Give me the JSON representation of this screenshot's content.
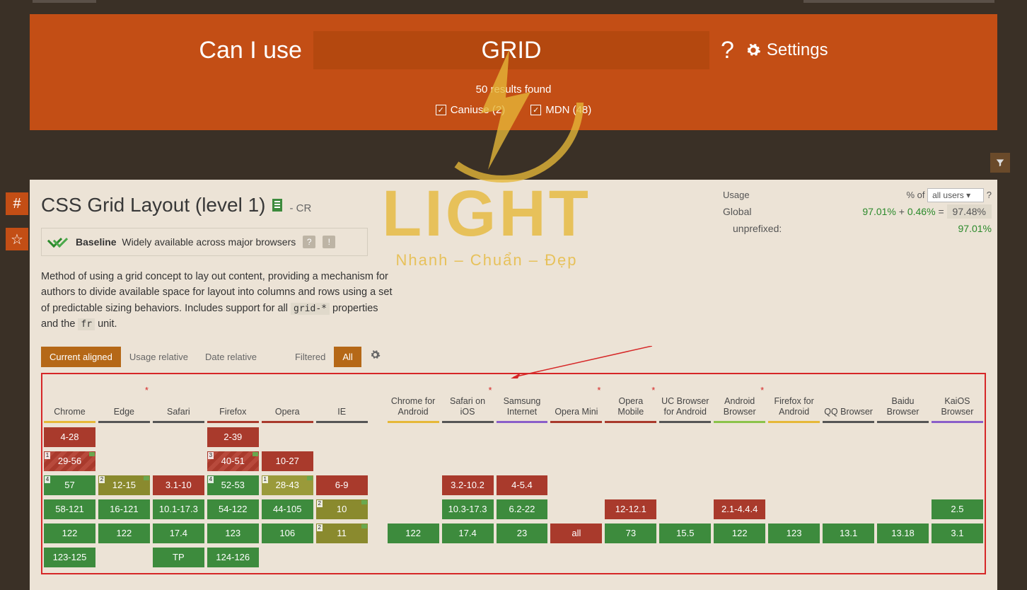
{
  "hero": {
    "label": "Can I use",
    "search_value": "GRID",
    "question": "?",
    "settings": "Settings",
    "results": "50 results found",
    "filter_caniuse": "Caniuse (2)",
    "filter_mdn": "MDN (48)"
  },
  "feature": {
    "title": "CSS Grid Layout (level 1)",
    "status": "- CR",
    "baseline_bold": "Baseline",
    "baseline_text": "Widely available across major browsers",
    "description": "Method of using a grid concept to lay out content, providing a mechanism for authors to divide available space for layout into columns and rows using a set of predictable sizing behaviors. Includes support for all ",
    "code1": "grid-*",
    "desc_mid": " properties and the ",
    "code2": "fr",
    "desc_end": " unit."
  },
  "usage": {
    "label_usage": "Usage",
    "label_pctof": "% of",
    "selector": "all users",
    "q": "?",
    "global_label": "Global",
    "pct1": "97.01%",
    "plus": "+",
    "pct2": "0.46%",
    "eq": "=",
    "total": "97.48%",
    "unprefix_label": "unprefixed:",
    "unprefix_val": "97.01%"
  },
  "tabs": {
    "current": "Current aligned",
    "usage": "Usage relative",
    "date": "Date relative",
    "filtered": "Filtered",
    "all": "All"
  },
  "browsers": [
    {
      "name": "Chrome",
      "bar": "#e6b838",
      "star": false,
      "cells": [
        {
          "v": "4-28",
          "c": "red"
        },
        {
          "v": "29-56",
          "c": "redh",
          "tag": "1",
          "flag": true
        },
        {
          "v": "57",
          "c": "grn",
          "tag": "4"
        },
        {
          "v": "58-121",
          "c": "grn"
        },
        {
          "v": "122",
          "c": "grn"
        },
        {
          "v": "123-125",
          "c": "grn"
        }
      ]
    },
    {
      "name": "Edge",
      "bar": "#555",
      "star": true,
      "cells": [
        {
          "v": "",
          "c": "empty"
        },
        {
          "v": "",
          "c": "empty"
        },
        {
          "v": "12-15",
          "c": "olv",
          "tag": "2",
          "flag": true
        },
        {
          "v": "16-121",
          "c": "grn"
        },
        {
          "v": "122",
          "c": "grn"
        },
        {
          "v": "",
          "c": "empty"
        }
      ]
    },
    {
      "name": "Safari",
      "bar": "#555",
      "star": false,
      "cells": [
        {
          "v": "",
          "c": "empty"
        },
        {
          "v": "",
          "c": "empty"
        },
        {
          "v": "3.1-10",
          "c": "red"
        },
        {
          "v": "10.1-17.3",
          "c": "grn"
        },
        {
          "v": "17.4",
          "c": "grn"
        },
        {
          "v": "TP",
          "c": "grn"
        }
      ]
    },
    {
      "name": "Firefox",
      "bar": "#a93a2c",
      "star": false,
      "cells": [
        {
          "v": "2-39",
          "c": "red"
        },
        {
          "v": "40-51",
          "c": "redh",
          "tag": "3",
          "flag": true
        },
        {
          "v": "52-53",
          "c": "grn",
          "tag": "4"
        },
        {
          "v": "54-122",
          "c": "grn"
        },
        {
          "v": "123",
          "c": "grn"
        },
        {
          "v": "124-126",
          "c": "grn"
        }
      ]
    },
    {
      "name": "Opera",
      "bar": "#a93a2c",
      "star": false,
      "cells": [
        {
          "v": "",
          "c": "empty"
        },
        {
          "v": "10-27",
          "c": "red"
        },
        {
          "v": "28-43",
          "c": "olv2",
          "tag": "1",
          "flag": true
        },
        {
          "v": "44-105",
          "c": "grn"
        },
        {
          "v": "106",
          "c": "grn"
        },
        {
          "v": "",
          "c": "empty"
        }
      ]
    },
    {
      "name": "IE",
      "bar": "#555",
      "star": false,
      "cells": [
        {
          "v": "",
          "c": "empty"
        },
        {
          "v": "",
          "c": "empty"
        },
        {
          "v": "6-9",
          "c": "red"
        },
        {
          "v": "10",
          "c": "olv",
          "tag": "2",
          "flag": true
        },
        {
          "v": "11",
          "c": "olv",
          "tag": "2",
          "flag": true
        },
        {
          "v": "",
          "c": "empty"
        }
      ]
    },
    {
      "name": "Chrome for Android",
      "bar": "#e6b838",
      "star": false,
      "gap": true,
      "cells": [
        {
          "v": "",
          "c": "empty"
        },
        {
          "v": "",
          "c": "empty"
        },
        {
          "v": "",
          "c": "empty"
        },
        {
          "v": "",
          "c": "empty"
        },
        {
          "v": "122",
          "c": "grn"
        },
        {
          "v": "",
          "c": "empty"
        }
      ]
    },
    {
      "name": "Safari on iOS",
      "bar": "#555",
      "star": true,
      "cells": [
        {
          "v": "",
          "c": "empty"
        },
        {
          "v": "",
          "c": "empty"
        },
        {
          "v": "3.2-10.2",
          "c": "red"
        },
        {
          "v": "10.3-17.3",
          "c": "grn"
        },
        {
          "v": "17.4",
          "c": "grn"
        },
        {
          "v": "",
          "c": "empty"
        }
      ]
    },
    {
      "name": "Samsung Internet",
      "bar": "#8a5ec9",
      "star": false,
      "cells": [
        {
          "v": "",
          "c": "empty"
        },
        {
          "v": "",
          "c": "empty"
        },
        {
          "v": "4-5.4",
          "c": "red"
        },
        {
          "v": "6.2-22",
          "c": "grn"
        },
        {
          "v": "23",
          "c": "grn"
        },
        {
          "v": "",
          "c": "empty"
        }
      ]
    },
    {
      "name": "Opera Mini",
      "bar": "#a93a2c",
      "star": true,
      "cells": [
        {
          "v": "",
          "c": "empty"
        },
        {
          "v": "",
          "c": "empty"
        },
        {
          "v": "",
          "c": "empty"
        },
        {
          "v": "",
          "c": "empty"
        },
        {
          "v": "all",
          "c": "red"
        },
        {
          "v": "",
          "c": "empty"
        }
      ]
    },
    {
      "name": "Opera Mobile",
      "bar": "#a93a2c",
      "star": true,
      "cells": [
        {
          "v": "",
          "c": "empty"
        },
        {
          "v": "",
          "c": "empty"
        },
        {
          "v": "",
          "c": "empty"
        },
        {
          "v": "12-12.1",
          "c": "red"
        },
        {
          "v": "73",
          "c": "grn"
        },
        {
          "v": "",
          "c": "empty"
        }
      ]
    },
    {
      "name": "UC Browser for Android",
      "bar": "#555",
      "star": false,
      "cells": [
        {
          "v": "",
          "c": "empty"
        },
        {
          "v": "",
          "c": "empty"
        },
        {
          "v": "",
          "c": "empty"
        },
        {
          "v": "",
          "c": "empty"
        },
        {
          "v": "15.5",
          "c": "grn"
        },
        {
          "v": "",
          "c": "empty"
        }
      ]
    },
    {
      "name": "Android Browser",
      "bar": "#8bc34a",
      "star": true,
      "cells": [
        {
          "v": "",
          "c": "empty"
        },
        {
          "v": "",
          "c": "empty"
        },
        {
          "v": "",
          "c": "empty"
        },
        {
          "v": "2.1-4.4.4",
          "c": "red"
        },
        {
          "v": "122",
          "c": "grn"
        },
        {
          "v": "",
          "c": "empty"
        }
      ]
    },
    {
      "name": "Firefox for Android",
      "bar": "#e6b838",
      "star": false,
      "cells": [
        {
          "v": "",
          "c": "empty"
        },
        {
          "v": "",
          "c": "empty"
        },
        {
          "v": "",
          "c": "empty"
        },
        {
          "v": "",
          "c": "empty"
        },
        {
          "v": "123",
          "c": "grn"
        },
        {
          "v": "",
          "c": "empty"
        }
      ]
    },
    {
      "name": "QQ Browser",
      "bar": "#555",
      "star": false,
      "cells": [
        {
          "v": "",
          "c": "empty"
        },
        {
          "v": "",
          "c": "empty"
        },
        {
          "v": "",
          "c": "empty"
        },
        {
          "v": "",
          "c": "empty"
        },
        {
          "v": "13.1",
          "c": "grn"
        },
        {
          "v": "",
          "c": "empty"
        }
      ]
    },
    {
      "name": "Baidu Browser",
      "bar": "#555",
      "star": false,
      "cells": [
        {
          "v": "",
          "c": "empty"
        },
        {
          "v": "",
          "c": "empty"
        },
        {
          "v": "",
          "c": "empty"
        },
        {
          "v": "",
          "c": "empty"
        },
        {
          "v": "13.18",
          "c": "grn"
        },
        {
          "v": "",
          "c": "empty"
        }
      ]
    },
    {
      "name": "KaiOS Browser",
      "bar": "#8a5ec9",
      "star": false,
      "cells": [
        {
          "v": "",
          "c": "empty"
        },
        {
          "v": "",
          "c": "empty"
        },
        {
          "v": "",
          "c": "empty"
        },
        {
          "v": "2.5",
          "c": "grn"
        },
        {
          "v": "3.1",
          "c": "grn"
        },
        {
          "v": "",
          "c": "empty"
        }
      ]
    }
  ],
  "watermark": {
    "big": "LIGHT",
    "small": "Nhanh – Chuẩn – Đẹp"
  }
}
